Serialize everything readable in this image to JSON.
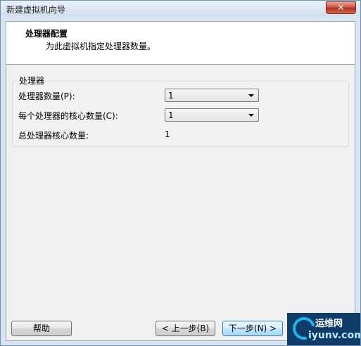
{
  "window": {
    "title": "新建虚拟机向导",
    "close_label": "✕"
  },
  "header": {
    "title": "处理器配置",
    "description": "为此虚拟机指定处理器数量。"
  },
  "processors": {
    "group_label": "处理器",
    "count_label": "处理器数量(P):",
    "count_value": "1",
    "cores_label": "每个处理器的核心数量(C):",
    "cores_value": "1",
    "total_label": "总处理器核心数量:",
    "total_value": "1"
  },
  "buttons": {
    "help": "帮助",
    "back": "< 上一步(B)",
    "next": "下一步(N) >"
  },
  "watermark": {
    "top_text": "运维网",
    "bottom_text": "iyunv.com"
  },
  "colors": {
    "titlebar": "#d2dfee",
    "close": "#c9513d",
    "next_button": "#bee6fd",
    "watermark_bg": "#0e3b68"
  }
}
